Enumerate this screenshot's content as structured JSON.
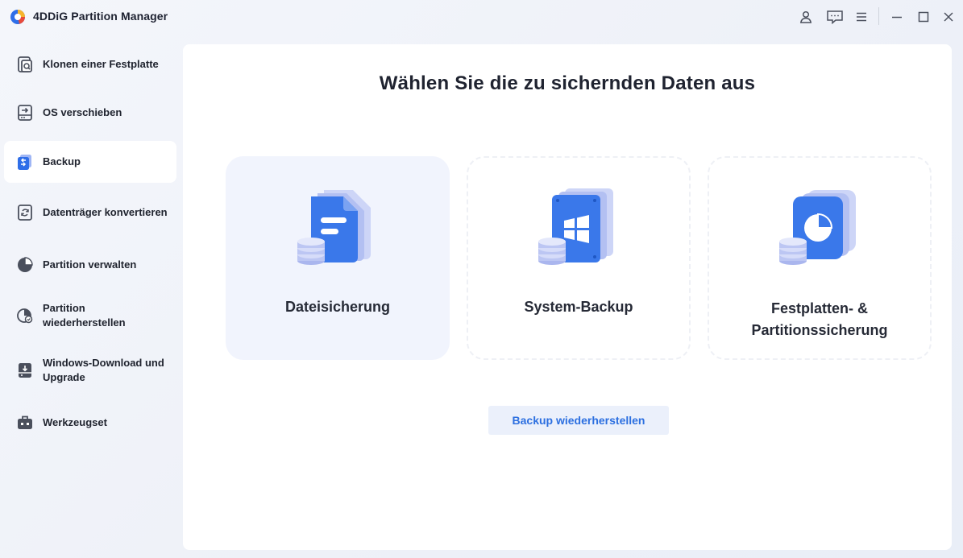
{
  "app": {
    "title": "4DDiG Partition Manager",
    "logo_icon": "4ddig-logo-icon"
  },
  "titlebar": {
    "icons": [
      "account-icon",
      "feedback-icon",
      "menu-icon",
      "minimize-icon",
      "maximize-icon",
      "close-icon"
    ]
  },
  "sidebar": {
    "items": [
      {
        "label": "Klonen einer Festplatte",
        "icon": "clone-disk-icon",
        "active": false
      },
      {
        "label": "OS verschieben",
        "icon": "migrate-os-icon",
        "active": false
      },
      {
        "label": "Backup",
        "icon": "backup-icon",
        "active": true
      },
      {
        "label": "Datenträger konvertieren",
        "icon": "convert-disk-icon",
        "active": false
      },
      {
        "label": "Partition verwalten",
        "icon": "partition-pie-icon",
        "active": false
      },
      {
        "label": "Partition wiederherstellen",
        "icon": "recover-partition-icon",
        "active": false
      },
      {
        "label": "Windows-Download und Upgrade",
        "icon": "windows-download-icon",
        "active": false
      },
      {
        "label": "Werkzeugset",
        "icon": "toolbox-icon",
        "active": false
      }
    ],
    "collapse_icon": "double-chevron-right-icon"
  },
  "main": {
    "title": "Wählen Sie die zu sichernden Daten aus",
    "cards": [
      {
        "label": "Dateisicherung",
        "icon": "file-backup-icon",
        "selected": true
      },
      {
        "label": "System-Backup",
        "icon": "system-backup-icon",
        "selected": false
      },
      {
        "label": "Festplatten- & Partitionssicherung",
        "icon": "disk-partition-backup-icon",
        "selected": false
      }
    ],
    "restore_button": "Backup wiederherstellen"
  },
  "colors": {
    "accent": "#2c6fe0",
    "icon_blue": "#3a78ea",
    "icon_lavender": "#b8c3f2",
    "selected_card_bg": "#f1f4fd",
    "sidebar_icon": "#4a4f5c"
  }
}
